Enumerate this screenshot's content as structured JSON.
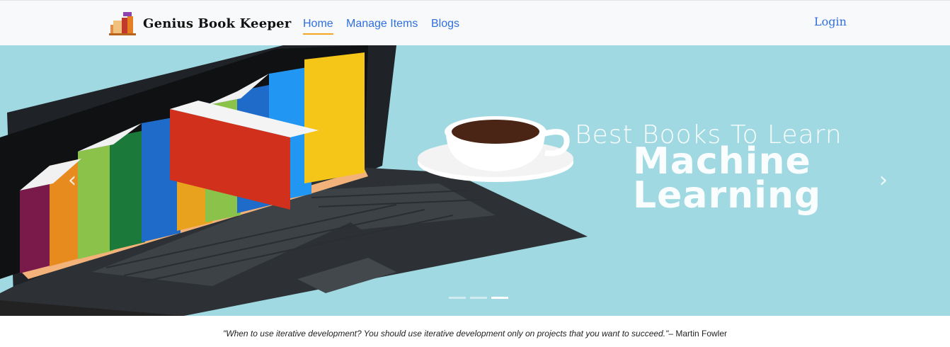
{
  "navbar": {
    "brand": "Genius Book Keeper",
    "links": [
      {
        "label": "Home",
        "active": true
      },
      {
        "label": "Manage Items",
        "active": false
      },
      {
        "label": "Blogs",
        "active": false
      }
    ],
    "login_label": "Login",
    "colors": {
      "link": "#2f6fe0",
      "active_underline": "#f5a623",
      "background": "#f8f9fa"
    }
  },
  "carousel": {
    "headline_line1": "Best Books To Learn",
    "headline_line2": "Machine",
    "headline_line3": "Learning",
    "prev_icon": "chevron-left",
    "next_icon": "chevron-right",
    "slide_count": 3,
    "active_slide": 3,
    "background_color": "#a0d9e2"
  },
  "quote": {
    "text": "\"When to use iterative development? You should use iterative development only on projects that you want to succeed.\"",
    "author": "– Martin Fowler"
  }
}
